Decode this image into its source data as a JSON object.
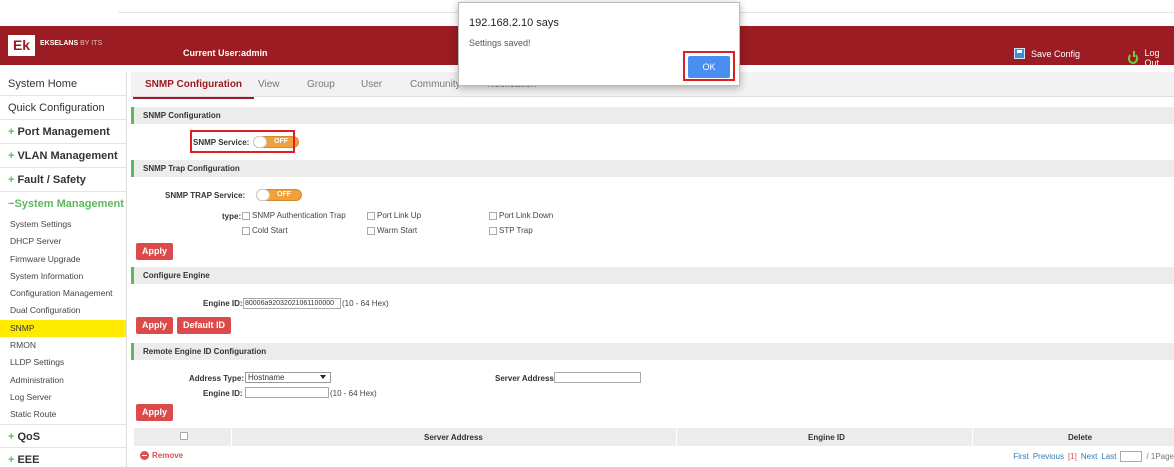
{
  "header": {
    "logo_text": "Ek",
    "brand": "EKSELANS",
    "brand_sub": "BY ITS",
    "current_user": "Current User:admin",
    "save_config": "Save Config",
    "logout": "Log Out",
    "color": "#9b1c22"
  },
  "sidebar": {
    "items": [
      {
        "label": "System Home"
      },
      {
        "label": "Quick Configuration"
      },
      {
        "label": "Port Management"
      },
      {
        "label": "VLAN Management"
      },
      {
        "label": "Fault / Safety"
      },
      {
        "label": "System Management"
      }
    ],
    "sub_items": [
      "System Settings",
      "DHCP Server",
      "Firmware Upgrade",
      "System Information",
      "Configuration Management",
      "Dual Configuration",
      "SNMP",
      "RMON",
      "LLDP Settings",
      "Administration",
      "Log Server",
      "Static Route"
    ],
    "after_items": [
      {
        "label": "QoS"
      },
      {
        "label": "EEE"
      }
    ],
    "plus": "+",
    "minus": "−"
  },
  "tabs": [
    "SNMP Configuration",
    "View",
    "Group",
    "User",
    "Community",
    "Notification"
  ],
  "snmp_config": {
    "title": "SNMP Configuration",
    "service_label": "SNMP Service:",
    "service_state": "OFF"
  },
  "trap_config": {
    "title": "SNMP Trap Configuration",
    "service_label": "SNMP TRAP Service:",
    "service_state": "OFF",
    "type_label": "type:",
    "types": [
      "SNMP Authentication Trap",
      "Port Link Up",
      "Port Link Down",
      "Cold Start",
      "Warm Start",
      "STP Trap"
    ],
    "apply": "Apply"
  },
  "engine": {
    "title": "Configure Engine",
    "engine_id_label": "Engine ID:",
    "engine_id_value": "80006a92032021061100000",
    "hint": "(10 - 64 Hex)",
    "apply": "Apply",
    "default_id": "Default ID"
  },
  "remote_engine": {
    "title": "Remote Engine ID Configuration",
    "address_type_label": "Address Type:",
    "address_type_value": "Hostname",
    "server_address_label": "Server Address:",
    "engine_id_label": "Engine ID:",
    "hint": "(10 - 64 Hex)",
    "apply": "Apply"
  },
  "table": {
    "columns": [
      "Server Address",
      "Engine ID",
      "Delete"
    ],
    "remove": "Remove",
    "pager": {
      "first": "First",
      "previous": "Previous",
      "current": "[1]",
      "next": "Next",
      "last": "Last",
      "total": "/ 1Page"
    }
  },
  "dialog": {
    "title": "192.168.2.10 says",
    "message": "Settings saved!",
    "ok": "OK"
  }
}
